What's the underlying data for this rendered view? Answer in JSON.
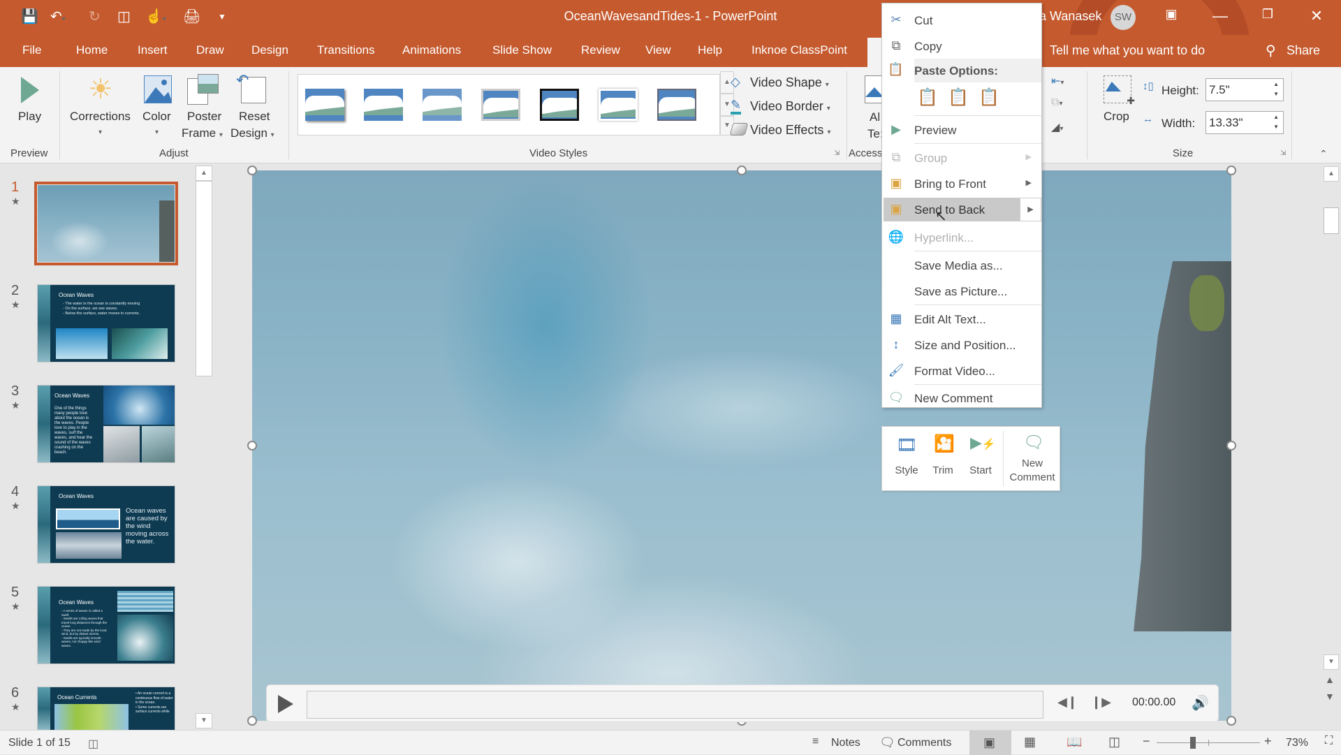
{
  "window": {
    "title": "OceanWavesandTides-1  -  PowerPoint",
    "user_name": "a Wanasek",
    "user_initials": "SW",
    "brand_color": "#c55a2e"
  },
  "quick_access": {
    "save": "save-icon",
    "undo": "undo-icon",
    "redo": "redo-icon",
    "present": "present-from-start-icon",
    "touch": "touch-mode-icon",
    "print": "print-preview-icon",
    "customize": "customize-qat-icon"
  },
  "tabs": [
    "File",
    "Home",
    "Insert",
    "Draw",
    "Design",
    "Transitions",
    "Animations",
    "Slide Show",
    "Review",
    "View",
    "Help",
    "Inknoe ClassPoint"
  ],
  "tell_me": "Tell me what you want to do",
  "share": "Share",
  "ribbon": {
    "preview_group": {
      "label": "Preview",
      "play": "Play"
    },
    "adjust_group": {
      "label": "Adjust",
      "corrections": "Corrections",
      "color": "Color",
      "poster_frame_1": "Poster",
      "poster_frame_2": "Frame",
      "reset_design_1": "Reset",
      "reset_design_2": "Design"
    },
    "video_styles_group": {
      "label": "Video Styles",
      "video_shape": "Video Shape",
      "video_border": "Video Border",
      "video_effects": "Video Effects"
    },
    "accessibility_group": {
      "label": "Access",
      "alt_text_1": "Al",
      "alt_text_2": "Te:"
    },
    "size_group": {
      "label": "Size",
      "crop": "Crop",
      "height_label": "Height:",
      "height_value": "7.5\"",
      "width_label": "Width:",
      "width_value": "13.33\""
    }
  },
  "context_menu": {
    "items": [
      {
        "label": "Cut",
        "icon": "scissors-icon",
        "enabled": true
      },
      {
        "label": "Copy",
        "icon": "copy-icon",
        "enabled": true
      },
      {
        "label": "Paste Options:",
        "icon": "paste-icon",
        "enabled": true,
        "header": true
      },
      {
        "label": "Preview",
        "icon": "play-icon",
        "enabled": true
      },
      {
        "label": "Group",
        "icon": "group-icon",
        "enabled": false,
        "submenu": true
      },
      {
        "label": "Bring to Front",
        "icon": "bring-front-icon",
        "enabled": true,
        "submenu": true
      },
      {
        "label": "Send to Back",
        "icon": "send-back-icon",
        "enabled": true,
        "submenu": true,
        "highlighted": true
      },
      {
        "label": "Hyperlink...",
        "icon": "hyperlink-icon",
        "enabled": false
      },
      {
        "label": "Save Media as...",
        "enabled": true
      },
      {
        "label": "Save as Picture...",
        "enabled": true
      },
      {
        "label": "Edit Alt Text...",
        "icon": "alt-text-icon",
        "enabled": true
      },
      {
        "label": "Size and Position...",
        "icon": "size-position-icon",
        "enabled": true
      },
      {
        "label": "Format Video...",
        "icon": "format-video-icon",
        "enabled": true
      },
      {
        "label": "New Comment",
        "icon": "comment-icon",
        "enabled": true
      }
    ],
    "paste_options": [
      "use-destination-theme",
      "keep-source-formatting",
      "keep-text-only"
    ]
  },
  "mini_toolbar": {
    "style": "Style",
    "trim": "Trim",
    "start": "Start",
    "new_comment_1": "New",
    "new_comment_2": "Comment"
  },
  "slides": [
    {
      "num": "1",
      "selected": true,
      "title": ""
    },
    {
      "num": "2",
      "title": "Ocean Waves",
      "bullets": [
        "The water in the ocean is constantly moving",
        "On the surface, we see waves.",
        "Below the surface, water moves in currents."
      ]
    },
    {
      "num": "3",
      "title": "Ocean Waves",
      "bullets": [
        "One of the things many people love about the ocean is the waves. People love to play in the waves, surf the waves, and hear the sound of the waves crashing on the beach."
      ]
    },
    {
      "num": "4",
      "title": "Ocean Waves",
      "bullets": [
        "Ocean waves are caused by the wind moving across the water."
      ]
    },
    {
      "num": "5",
      "title": "Ocean Waves",
      "bullets": [
        "A series of waves is called a swell.",
        "Swells are rolling waves that travel long distances through the ocean.",
        "They are not made by the local wind, but by distant storms.",
        "Swells are typically smooth waves, not choppy like wind waves."
      ]
    },
    {
      "num": "6",
      "title": "Ocean Currents",
      "bullets": [
        "An ocean current is a continuous flow of water in the ocean.",
        "Some currents are surface currents while"
      ]
    }
  ],
  "video_player": {
    "time": "00:00.00",
    "progress": 0
  },
  "status": {
    "slide_info": "Slide 1 of 15",
    "notes": "Notes",
    "comments": "Comments",
    "zoom": "73%",
    "zoom_level": 0.73
  }
}
